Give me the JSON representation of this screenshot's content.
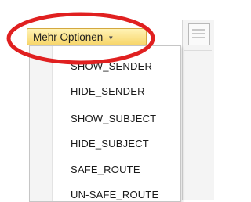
{
  "menu_button": {
    "label": "Mehr Optionen",
    "arrow_icon": "triangle-down-icon"
  },
  "menu": {
    "items": [
      {
        "label": "SHOW_SENDER"
      },
      {
        "label": "HIDE_SENDER"
      },
      {
        "label": "SHOW_SUBJECT"
      },
      {
        "label": "HIDE_SUBJECT"
      },
      {
        "label": "SAFE_ROUTE"
      },
      {
        "label": "UN-SAFE_ROUTE"
      }
    ]
  },
  "annotation": {
    "shape": "ellipse",
    "color": "#e02020"
  },
  "colors": {
    "button_top": "#fff3b6",
    "button_bottom": "#f7d66b",
    "button_border": "#d3a83f"
  }
}
